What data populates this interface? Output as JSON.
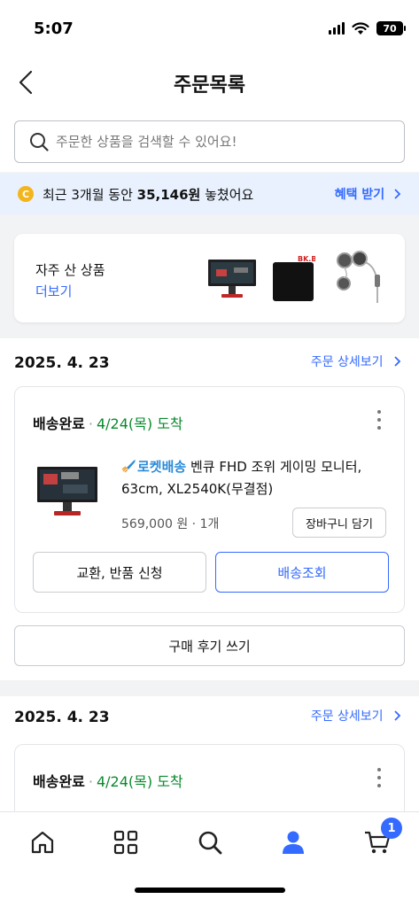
{
  "status_bar": {
    "time": "5:07",
    "battery": "70"
  },
  "header": {
    "title": "주문목록"
  },
  "search": {
    "placeholder": "주문한 상품을 검색할 수 있어요!"
  },
  "savings": {
    "coin": "C",
    "prefix": "최근 3개월 동안 ",
    "amount": "35,146원",
    "suffix": " 놓쳤어요",
    "link": "혜택 받기"
  },
  "frequent": {
    "title": "자주 산 상품",
    "more": "더보기",
    "mousepad_label": "BK.B"
  },
  "orders": [
    {
      "date": "2025. 4. 23",
      "detail_link": "주문 상세보기",
      "status": "배송완료",
      "separator": "·",
      "arrival": "4/24(목) 도착",
      "rocket_label": "로켓배송",
      "product_name": " 벤큐 FHD 조위 게이밍 모니터, 63cm, XL2540K(무결점)",
      "price": "569,000 원 · 1개",
      "cart_button": "장바구니 담기",
      "exchange_button": "교환, 반품 신청",
      "track_button": "배송조회",
      "review_button": "구매 후기 쓰기"
    },
    {
      "date": "2025. 4. 23",
      "detail_link": "주문 상세보기",
      "status": "배송완료",
      "separator": "·",
      "arrival": "4/24(목) 도착"
    }
  ],
  "bottom_nav": {
    "items": [
      "home-icon",
      "category-grid-icon",
      "search-icon",
      "my-page-icon",
      "cart-icon"
    ],
    "cart_badge": "1",
    "active_color": "#346aff"
  },
  "colors": {
    "accent": "#346aff",
    "delivered_green": "#0a8a2e",
    "banner_bg": "#e8f1fd",
    "coin": "#f3b51c"
  }
}
